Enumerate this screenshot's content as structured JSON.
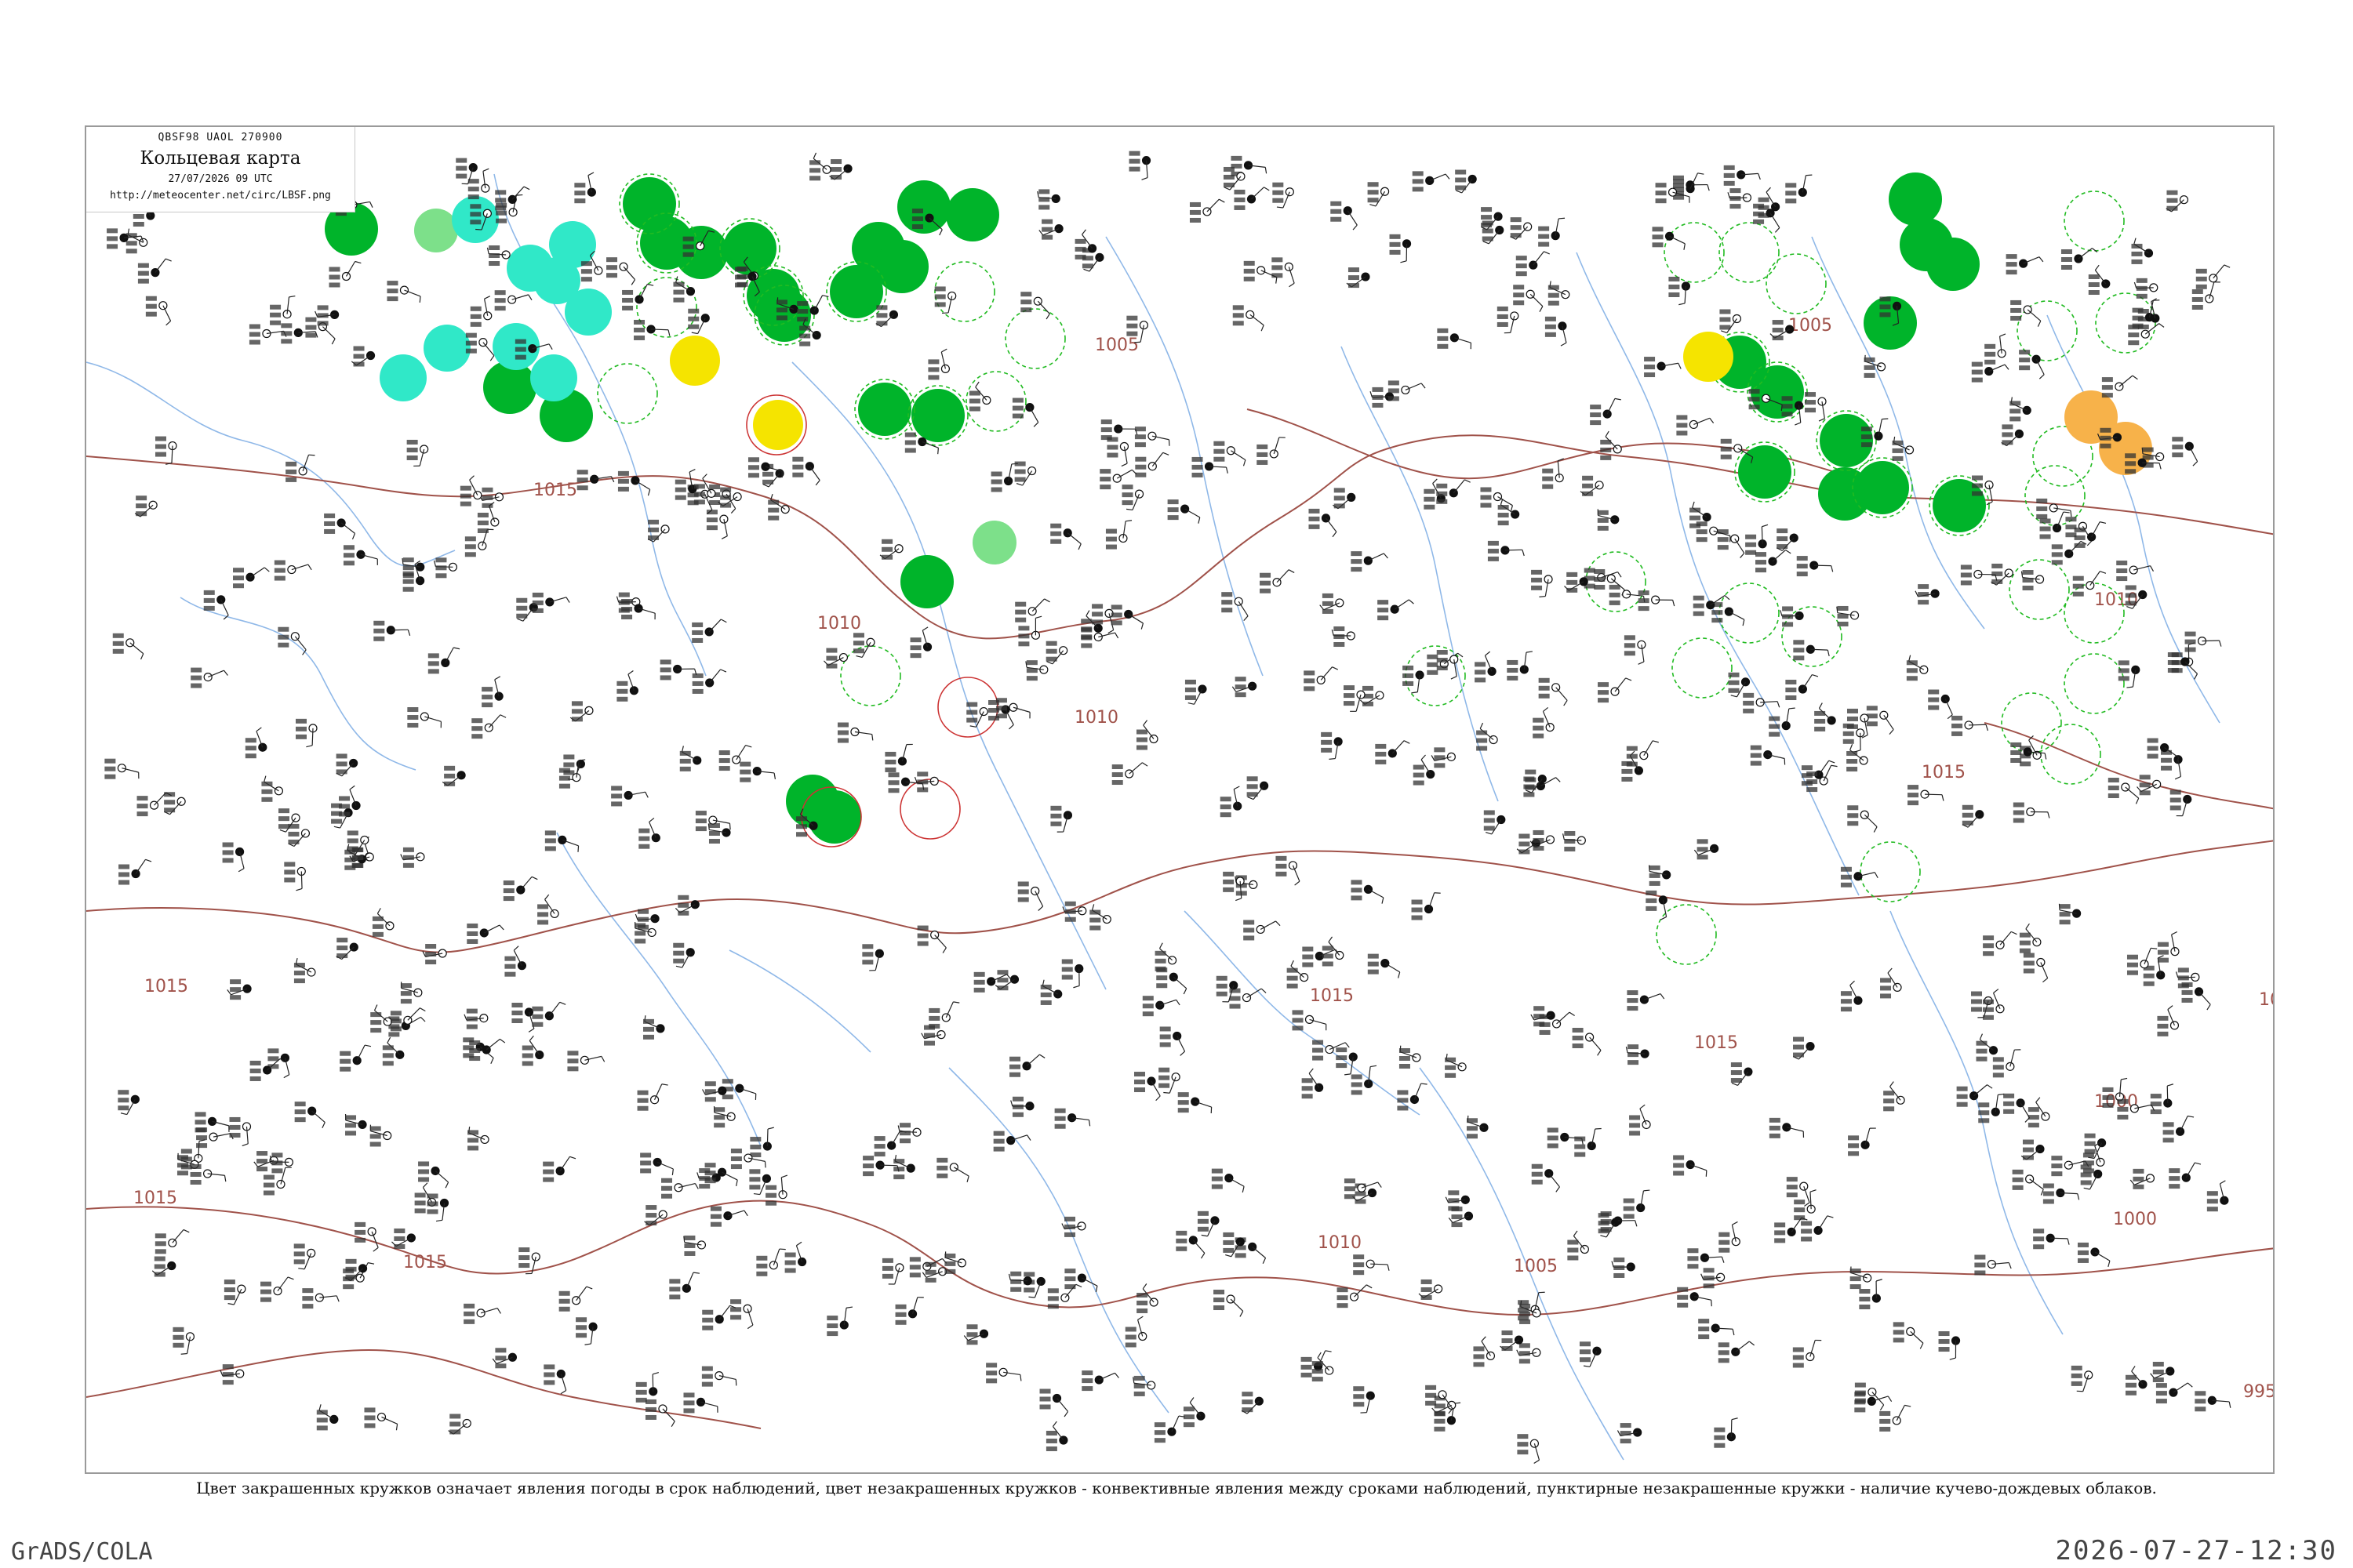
{
  "map": {
    "header": {
      "code": "QBSF98  UAOL  270900",
      "title": "Кольцевая карта",
      "time": "27/07/2026 09 UTC",
      "url": "http://meteocenter.net/circ/LBSF.png"
    },
    "caption": "Цвет закрашенных кружков означает явления погоды в срок наблюдений, цвет незакрашенных кружков - конвективные явления между сроками наблюдений, пунктирные незакрашенные кружки - наличие кучево-дождевых облаков.",
    "isobar_labels": [
      "1015",
      "1010",
      "1005",
      "1000",
      "995"
    ],
    "colors": {
      "isobar": "#a0524a",
      "rivers": "#8fb8e8",
      "coast": "#7aaee0",
      "rain": "#00b42a",
      "drizzle": "#7de08a",
      "fog": "#30e8c8",
      "thunder": "#f5e400",
      "haze": "#f7b24a",
      "dashed_cb": "#22bb22",
      "convective": "#cc3333"
    }
  },
  "footer": {
    "software": "GrADS/COLA",
    "timestamp": "2026-07-27-12:30"
  }
}
